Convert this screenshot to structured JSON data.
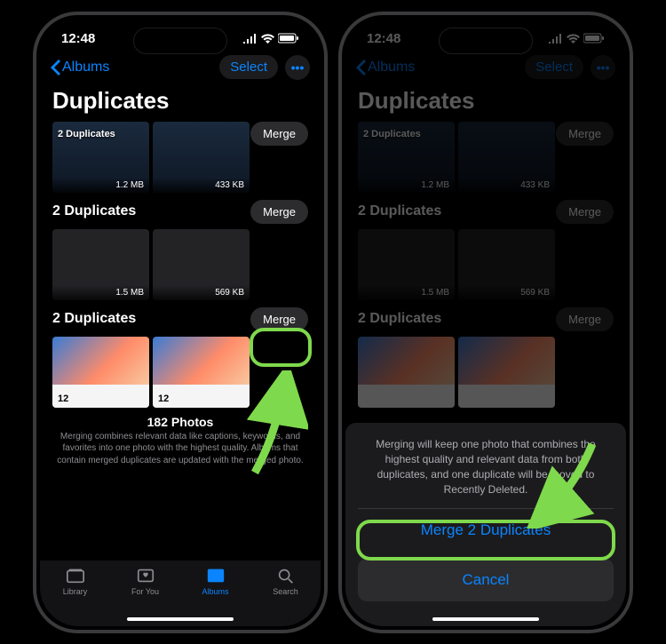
{
  "statusbar": {
    "time": "12:48"
  },
  "nav": {
    "back": "Albums",
    "select": "Select",
    "more": "•••"
  },
  "title": "Duplicates",
  "groups": [
    {
      "title": "2 Duplicates",
      "merge": "Merge",
      "sizes": [
        "1.2 MB",
        "433 KB"
      ]
    },
    {
      "title": "2 Duplicates",
      "merge": "Merge",
      "sizes": [
        "1.5 MB",
        "569 KB"
      ]
    },
    {
      "title": "2 Duplicates",
      "merge": "Merge",
      "sizes": [
        "12",
        "12"
      ]
    }
  ],
  "footer": {
    "count": "182 Photos",
    "desc": "Merging combines relevant data like captions, keywords, and favorites into one photo with the highest quality. Albums that contain merged duplicates are updated with the merged photo."
  },
  "tabs": [
    {
      "label": "Library"
    },
    {
      "label": "For You"
    },
    {
      "label": "Albums"
    },
    {
      "label": "Search"
    }
  ],
  "sheet": {
    "message": "Merging will keep one photo that combines the highest quality and relevant data from both duplicates, and one duplicate will be moved to Recently Deleted.",
    "action": "Merge 2 Duplicates",
    "cancel": "Cancel"
  }
}
